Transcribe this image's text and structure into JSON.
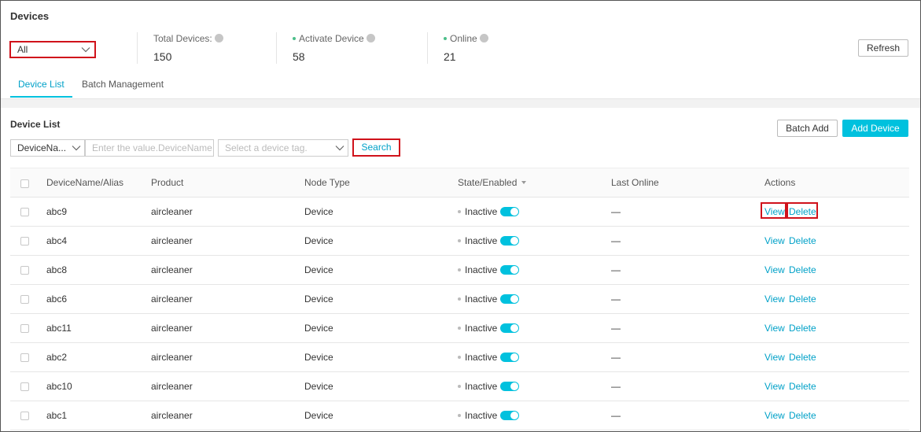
{
  "page": {
    "title": "Devices"
  },
  "filter": {
    "scope_value": "All"
  },
  "stats": {
    "total": {
      "label": "Total Devices:",
      "value": "150"
    },
    "activated": {
      "label": "Activate Device",
      "value": "58"
    },
    "online": {
      "label": "Online",
      "value": "21"
    }
  },
  "toolbar": {
    "refresh": "Refresh"
  },
  "tabs": [
    {
      "label": "Device List",
      "active": true
    },
    {
      "label": "Batch Management",
      "active": false
    }
  ],
  "device_list": {
    "title": "Device List",
    "batch_add": "Batch Add",
    "add_device": "Add Device",
    "search_field_value": "DeviceNa...",
    "search_input_placeholder": "Enter the value.DeviceName",
    "tag_select_placeholder": "Select a device tag.",
    "search_button": "Search"
  },
  "table": {
    "columns": [
      "DeviceName/Alias",
      "Product",
      "Node Type",
      "State/Enabled",
      "Last Online",
      "Actions"
    ],
    "rows": [
      {
        "name": "abc9",
        "product": "aircleaner",
        "node_type": "Device",
        "state": "Inactive",
        "enabled": true,
        "last_online": "—",
        "view": "View",
        "delete": "Delete"
      },
      {
        "name": "abc4",
        "product": "aircleaner",
        "node_type": "Device",
        "state": "Inactive",
        "enabled": true,
        "last_online": "—",
        "view": "View",
        "delete": "Delete"
      },
      {
        "name": "abc8",
        "product": "aircleaner",
        "node_type": "Device",
        "state": "Inactive",
        "enabled": true,
        "last_online": "—",
        "view": "View",
        "delete": "Delete"
      },
      {
        "name": "abc6",
        "product": "aircleaner",
        "node_type": "Device",
        "state": "Inactive",
        "enabled": true,
        "last_online": "—",
        "view": "View",
        "delete": "Delete"
      },
      {
        "name": "abc11",
        "product": "aircleaner",
        "node_type": "Device",
        "state": "Inactive",
        "enabled": true,
        "last_online": "—",
        "view": "View",
        "delete": "Delete"
      },
      {
        "name": "abc2",
        "product": "aircleaner",
        "node_type": "Device",
        "state": "Inactive",
        "enabled": true,
        "last_online": "—",
        "view": "View",
        "delete": "Delete"
      },
      {
        "name": "abc10",
        "product": "aircleaner",
        "node_type": "Device",
        "state": "Inactive",
        "enabled": true,
        "last_online": "—",
        "view": "View",
        "delete": "Delete"
      },
      {
        "name": "abc1",
        "product": "aircleaner",
        "node_type": "Device",
        "state": "Inactive",
        "enabled": true,
        "last_online": "—",
        "view": "View",
        "delete": "Delete"
      }
    ]
  },
  "colors": {
    "accent": "#00c1de",
    "link": "#00a1c8",
    "highlight": "#d0121b",
    "online_dot": "#4cbf8a"
  }
}
